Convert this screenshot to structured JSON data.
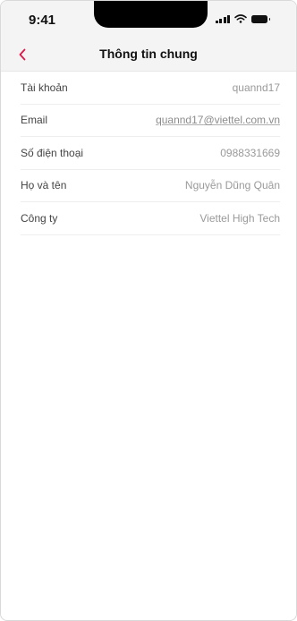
{
  "status_bar": {
    "time": "9:41"
  },
  "header": {
    "title": "Thông tin chung",
    "back_icon": "chevron-left-icon",
    "back_color": "#d8194a"
  },
  "info": {
    "rows": [
      {
        "label": "Tài khoản",
        "value": "quannd17"
      },
      {
        "label": "Email",
        "value": "quannd17@viettel.com.vn"
      },
      {
        "label": "Số điện thoại",
        "value": "0988331669"
      },
      {
        "label": "Họ và tên",
        "value": "Nguyễn Dũng Quân"
      },
      {
        "label": "Công ty",
        "value": "Viettel High Tech"
      }
    ]
  },
  "colors": {
    "accent": "#d8194a",
    "header_bg": "#f4f4f4"
  }
}
